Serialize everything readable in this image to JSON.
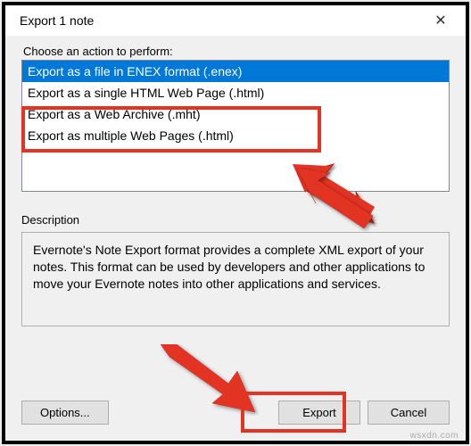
{
  "titlebar": {
    "title": "Export 1 note",
    "close_glyph": "✕"
  },
  "choose_label": "Choose an action to perform:",
  "options": [
    "Export as a file in ENEX format (.enex)",
    "Export as a single HTML Web Page (.html)",
    "Export as a Web Archive (.mht)",
    "Export as multiple Web Pages (.html)"
  ],
  "selected_index": 0,
  "description_label": "Description",
  "description_text": "Evernote's Note Export format provides a complete XML export of your notes. This format can be used by developers and other applications to move your Evernote notes into other applications and services.",
  "buttons": {
    "options": "Options...",
    "export": "Export",
    "cancel": "Cancel"
  },
  "annotation": {
    "arrow_color": "#e33423"
  },
  "watermark": "wsxdn.com"
}
